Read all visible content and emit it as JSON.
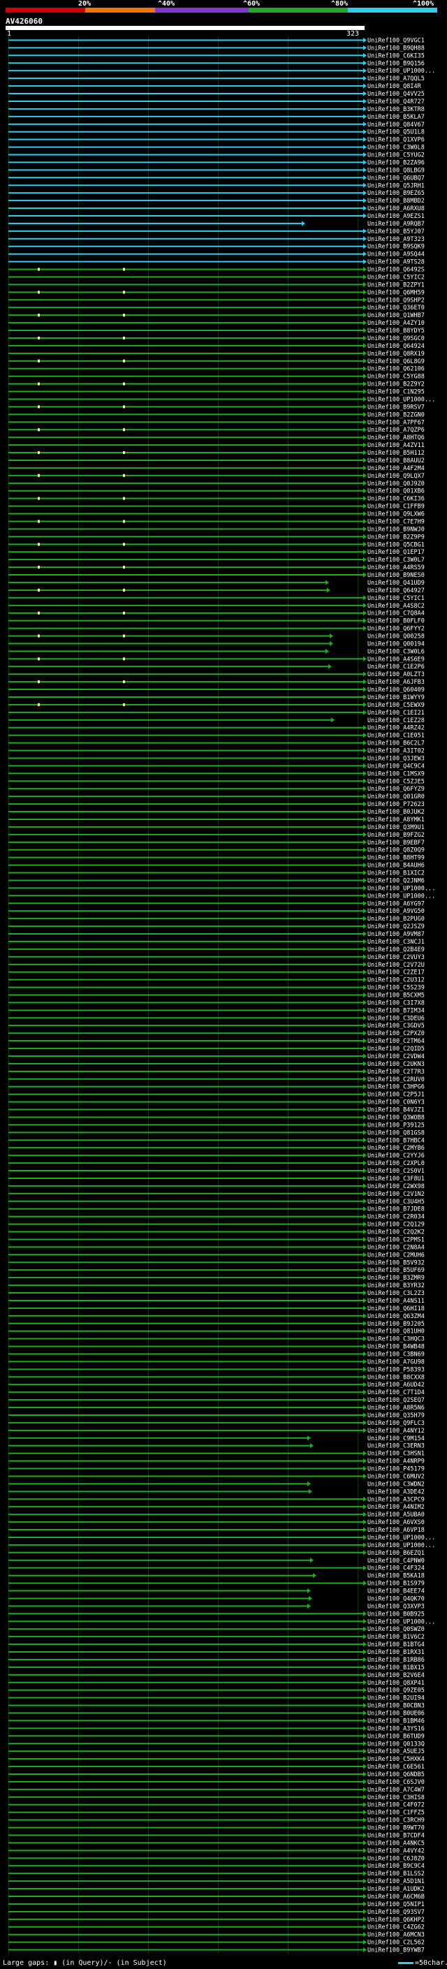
{
  "colors": {
    "background": "#000000",
    "bin_0_20": "#cc0000",
    "bin_20_40": "#ee7700",
    "bin_40_60": "#8833cc",
    "bin_60_80": "#22aa22",
    "bin_80_100": "#33ccee"
  },
  "scale": {
    "labels": [
      "20%",
      "^40%",
      "^60%",
      "^80%",
      "^100%"
    ]
  },
  "query": {
    "name": "AV426060",
    "start": "1",
    "end": "323"
  },
  "hits": [
    "UniRef100_Q9VGC1",
    "UniRef100_B9QH88",
    "UniRef100_C6KI35",
    "UniRef100_B9Q156",
    "UniRef100_UP1000...",
    "UniRef100_A7QQL5",
    "UniRef100_Q8I4R",
    "UniRef100_Q4VV25",
    "UniRef100_Q4R727",
    "UniRef100_B3KTR8",
    "UniRef100_B5KLA7",
    "UniRef100_Q84V67",
    "UniRef100_Q5U1L8",
    "UniRef100_Q1XVP6",
    "UniRef100_C3W0L8",
    "UniRef100_C5YUG2",
    "UniRef100_B2ZA96",
    "UniRef100_Q8LBG9",
    "UniRef100_Q6UBQ7",
    "UniRef100_Q5JRH1",
    "UniRef100_B9EZ65",
    "UniRef100_B8MBD2",
    "UniRef100_A6RXU8",
    "UniRef100_A9EZS1",
    "UniRef100_A9RQB7",
    "UniRef100_B5YJ07",
    "UniRef100_A9T323",
    "UniRef100_B9SQK9",
    "UniRef100_A9SQ44",
    "UniRef100_A9TS28",
    "UniRef100_Q6492S",
    "UniRef100_C5YIC2",
    "UniRef100_B2ZPY1",
    "UniRef100_Q6MH59",
    "UniRef100_Q9SHP2",
    "UniRef100_Q36ET0",
    "UniRef100_Q1WHB7",
    "UniRef100_A4ZY10",
    "UniRef100_B8YDY5",
    "UniRef100_Q9SGC0",
    "UniRef100_Q64924",
    "UniRef100_Q8RX19",
    "UniRef100_Q6L8G9",
    "UniRef100_Q62106",
    "UniRef100_C5YG88",
    "UniRef100_B2Z9Y2",
    "UniRef100_C1N295",
    "UniRef100_UP1000...",
    "UniRef100_B9RSV7",
    "UniRef100_B2ZGN0",
    "UniRef100_A7PF67",
    "UniRef100_A7QZP6",
    "UniRef100_A8HTQ6",
    "UniRef100_A4ZV11",
    "UniRef100_B5H112",
    "UniRef100_B8AUU2",
    "UniRef100_A4F2M4",
    "UniRef100_Q9LQX7",
    "UniRef100_Q0J9Z0",
    "UniRef100_Q01XB6",
    "UniRef100_C6KI36",
    "UniRef100_C1FFB9",
    "UniRef100_Q9LXW6",
    "UniRef100_C7E7H9",
    "UniRef100_B9NWJ0",
    "UniRef100_B2Z9P9",
    "UniRef100_Q5CBG1",
    "UniRef100_Q1EP17",
    "UniRef100_C3W0L7",
    "UniRef100_A4RS59",
    "UniRef100_B9NES0",
    "UniRef100_Q41UD9",
    "UniRef100_Q64927",
    "UniRef100_C5YIC1",
    "UniRef100_A4S8C2",
    "UniRef100_C7Q8A4",
    "UniRef100_B0FLF0",
    "UniRef100_Q6FYY2",
    "UniRef100_Q00258",
    "UniRef100_Q00194",
    "UniRef100_C3W0L6",
    "UniRef100_A4S6E9",
    "UniRef100_C1E2P6",
    "UniRef100_A0LZT3",
    "UniRef100_A6JFB3",
    "UniRef100_Q60409",
    "UniRef100_B1WYY9",
    "UniRef100_C5EWX9",
    "UniRef100_C1EI21",
    "UniRef100_C1EZ28",
    "UniRef100_A4RZ42",
    "UniRef100_C1E051",
    "UniRef100_B6C2L7",
    "UniRef100_A3IT02",
    "UniRef100_Q3JEW3",
    "UniRef100_Q4C9C4",
    "UniRef100_C1MSX9",
    "UniRef100_C5ZJE5",
    "UniRef100_Q6FYZ9",
    "UniRef100_Q01GR0",
    "UniRef100_P72623",
    "UniRef100_B0JUK2",
    "UniRef100_A8YMK1",
    "UniRef100_Q3M9U1",
    "UniRef100_B9FZG2",
    "UniRef100_B9EBF7",
    "UniRef100_Q8Z0Q9",
    "UniRef100_B8HT99",
    "UniRef100_B4AUH6",
    "UniRef100_B1XIC2",
    "UniRef100_Q2JNM6",
    "UniRef100_UP1000...",
    "UniRef100_UP1000...",
    "UniRef100_A6YG97",
    "UniRef100_A9VG50",
    "UniRef100_B2PUG0",
    "UniRef100_Q2JSZ9",
    "UniRef100_A9VM87",
    "UniRef100_C3NCJ1",
    "UniRef100_Q2B4E9",
    "UniRef100_C2VUY3",
    "UniRef100_C2V72U",
    "UniRef100_C2ZE17",
    "UniRef100_C2U312",
    "UniRef100_C5S239",
    "UniRef100_B5CXM5",
    "UniRef100_C3I7X8",
    "UniRef100_B7IM34",
    "UniRef100_C3DEU6",
    "UniRef100_C3GDV5",
    "UniRef100_C2PXZ0",
    "UniRef100_C2TM64",
    "UniRef100_C2QID5",
    "UniRef100_C2VDW4",
    "UniRef100_C2UKN3",
    "UniRef100_C2T7R3",
    "UniRef100_C2RUV0",
    "UniRef100_C3HPG6",
    "UniRef100_C2P5J1",
    "UniRef100_C0N6Y3",
    "UniRef100_B4VJZ1",
    "UniRef100_Q3WOB8",
    "UniRef100_P39125",
    "UniRef100_Q81GS8",
    "UniRef100_B7HBC4",
    "UniRef100_C2MYB6",
    "UniRef100_C2YYJ6",
    "UniRef100_C2XPL0",
    "UniRef100_C2S0V1",
    "UniRef100_C3F8U1",
    "UniRef100_C2WX98",
    "UniRef100_C2V1N2",
    "UniRef100_C3U4H5",
    "UniRef100_B7JDE8",
    "UniRef100_C2R034",
    "UniRef100_C2Q129",
    "UniRef100_C2Q2K2",
    "UniRef100_C2PMS1",
    "UniRef100_C2N8A4",
    "UniRef100_C2MUH6",
    "UniRef100_B5V932",
    "UniRef100_B5UF69",
    "UniRef100_B3ZMR9",
    "UniRef100_B3YR32",
    "UniRef100_C3L2Z3",
    "UniRef100_A4NS11",
    "UniRef100_Q6HI18",
    "UniRef100_Q63ZM4",
    "UniRef100_B9J205",
    "UniRef100_Q81UH0",
    "UniRef100_C3HQC3",
    "UniRef100_B4WB48",
    "UniRef100_C3BN69",
    "UniRef100_A7GU98",
    "UniRef100_P58393",
    "UniRef100_B8CXX8",
    "UniRef100_A6UD42",
    "UniRef100_C7T1D4",
    "UniRef100_Q2SEQ7",
    "UniRef100_A8R5N6",
    "UniRef100_Q35H79",
    "UniRef100_Q9FLC3",
    "UniRef100_A4NY12",
    "UniRef100_C9M154",
    "UniRef100_C3ERN3",
    "UniRef100_C3HSN1",
    "UniRef100_A4NRP9",
    "UniRef100_P45179",
    "UniRef100_C6MUV2",
    "UniRef100_C3WDN2",
    "UniRef100_A3DE42",
    "UniRef100_A3CPC9",
    "UniRef100_A4NIM2",
    "UniRef100_A5UBA0",
    "UniRef100_A6VXS0",
    "UniRef100_A6VP18",
    "UniRef100_UP1000...",
    "UniRef100_UP1000...",
    "UniRef100_B6EZQ1",
    "UniRef100_C4PNW0",
    "UniRef100_C4F324",
    "UniRef100_B5KA18",
    "UniRef100_B1S979",
    "UniRef100_B4EE74",
    "UniRef100_Q4QK70",
    "UniRef100_Q3XVP3",
    "UniRef100_B0B925",
    "UniRef100_UP1000...",
    "UniRef100_Q0SWZ0",
    "UniRef100_B1V6C2",
    "UniRef100_B1BTG4",
    "UniRef100_B1RX31",
    "UniRef100_B1RB86",
    "UniRef100_B1BX15",
    "UniRef100_B2V6E4",
    "UniRef100_Q8XP41",
    "UniRef100_Q9ZE05",
    "UniRef100_B2UI94",
    "UniRef100_B0CBN3",
    "UniRef100_B0UE06",
    "UniRef100_B1BM46",
    "UniRef100_A3YS16",
    "UniRef100_B6TUD9",
    "UniRef100_Q0133Q",
    "UniRef100_A5UEJ5",
    "UniRef100_C5HXK4",
    "UniRef100_C6E561",
    "UniRef100_Q6NDB5",
    "UniRef100_C6SJV0",
    "UniRef100_A7C4W7",
    "UniRef100_C3HIS8",
    "UniRef100_C4F072",
    "UniRef100_C1FFZ5",
    "UniRef100_C3RCH9",
    "UniRef100_B9WT70",
    "UniRef100_B7CDF4",
    "UniRef100_A4NKC5",
    "UniRef100_A4VY42",
    "UniRef100_C6J8Z0",
    "UniRef100_B9C9C4",
    "UniRef100_B1LSS2",
    "UniRef100_A5D1N1",
    "UniRef100_A1UDK2",
    "UniRef100_A6CM6B",
    "UniRef100_Q5NIP1",
    "UniRef100_Q93SV7",
    "UniRef100_Q6KHP2",
    "UniRef100_C4ZG62",
    "UniRef100_A6MCN3",
    "UniRef100_C2L562",
    "UniRef100_B9YWB7"
  ],
  "footer": {
    "text": "Large gaps: ▮ (in Query)/- (in Subject)",
    "legend": "=50char."
  }
}
